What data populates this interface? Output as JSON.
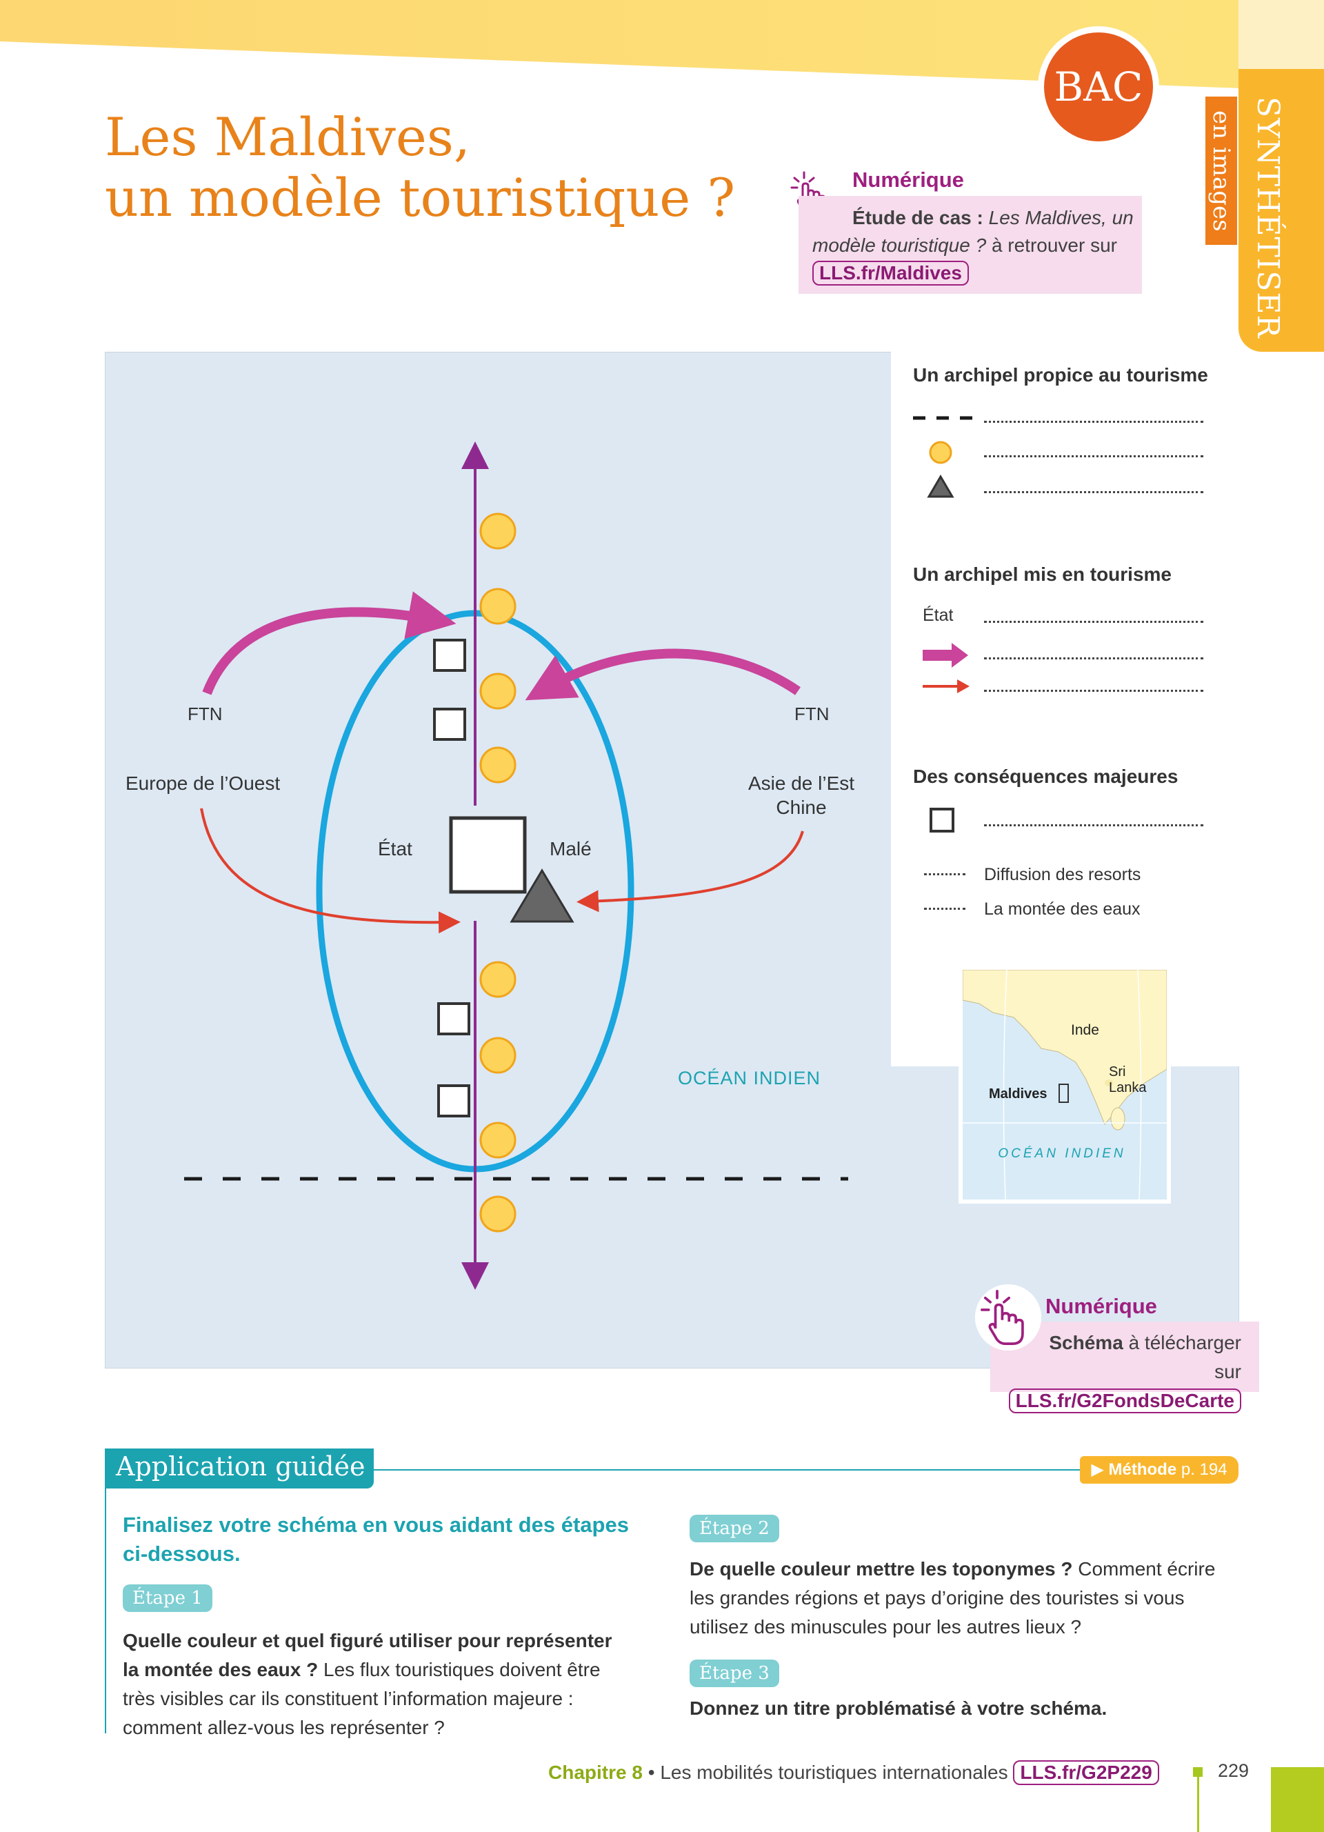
{
  "header": {
    "title_line1": "Les Maldives,",
    "title_line2": "un modèle touristique ?",
    "badge": "BAC",
    "side_tab_main": "SYNTHÉTISER",
    "side_tab_sub": "en images"
  },
  "numerique_top": {
    "title": "Numérique",
    "lead_bold": "Étude de cas :",
    "lead_italic": "Les Maldives, un modèle touristique ?",
    "text_after": "à retrouver sur",
    "link": "LLS.fr/Maldives"
  },
  "map": {
    "labels": {
      "ftn_left": "FTN",
      "ftn_right": "FTN",
      "europe": "Europe de l’Ouest",
      "asie_line1": "Asie de l’Est",
      "asie_line2": "Chine",
      "etat": "État",
      "male": "Malé",
      "ocean": "OCÉAN INDIEN"
    },
    "colors": {
      "sea": "#dde8f3",
      "ellipse": "#1aa6de",
      "axis": "#8e2a8f",
      "flow_pink": "#c9449a",
      "flow_red": "#e0402e",
      "resort": "#fdd35a"
    }
  },
  "legend": {
    "section1_title": "Un archipel propice au tourisme",
    "section2_title": "Un archipel mis en tourisme",
    "section2_etat": "État",
    "section3_title": "Des conséquences majeures",
    "diffusion": "Diffusion des resorts",
    "montee": "La montée des eaux"
  },
  "inset": {
    "inde": "Inde",
    "sri_line1": "Sri",
    "sri_line2": "Lanka",
    "maldives": "Maldives",
    "ocean": "OCÉAN INDIEN"
  },
  "numerique_bottom": {
    "title": "Numérique",
    "bold": "Schéma",
    "text": "à télécharger",
    "prefix": "sur",
    "link": "LLS.fr/G2FondsDeCarte"
  },
  "application": {
    "title": "Application guidée",
    "methode_label": "Méthode",
    "methode_page": "p. 194",
    "lead": "Finalisez votre schéma en vous aidant des étapes ci-dessous.",
    "etape1": {
      "label": "Étape 1",
      "bold": "Quelle couleur et quel figuré utiliser pour représenter la montée des eaux ?",
      "text": "Les flux touristiques doivent être très visibles car ils constituent l’information majeure : comment allez-vous les représenter ?"
    },
    "etape2": {
      "label": "Étape 2",
      "bold": "De quelle couleur mettre les toponymes ?",
      "text": "Comment écrire les grandes régions et pays d’origine des touristes si vous utilisez des minuscules pour les autres lieux ?"
    },
    "etape3": {
      "label": "Étape 3",
      "bold": "Donnez un titre problématisé à votre schéma."
    }
  },
  "footer": {
    "chapter": "Chapitre 8",
    "separator": "•",
    "subject": "Les mobilités touristiques internationales",
    "link": "LLS.fr/G2P229",
    "page": "229"
  }
}
